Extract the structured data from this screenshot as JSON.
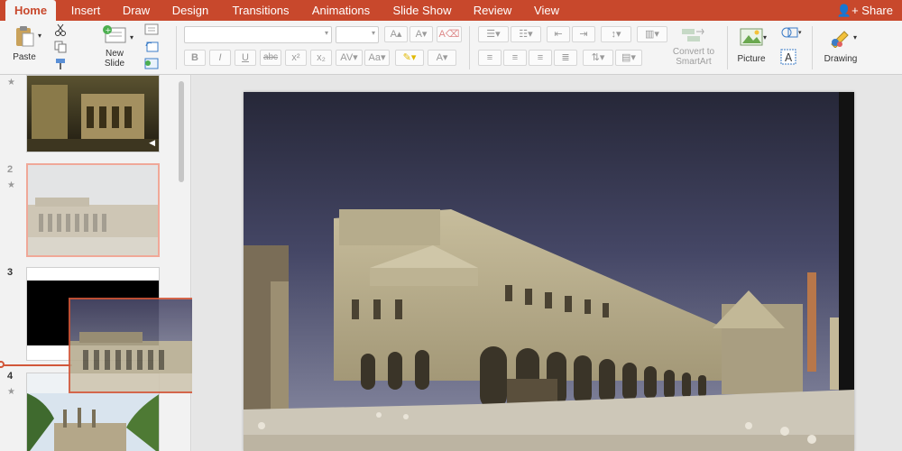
{
  "tabs": [
    "Home",
    "Insert",
    "Draw",
    "Design",
    "Transitions",
    "Animations",
    "Slide Show",
    "Review",
    "View"
  ],
  "share_label": "Share",
  "ribbon": {
    "paste": "Paste",
    "new_slide": "New Slide",
    "new_slide_line1": "New",
    "new_slide_line2": "Slide",
    "convert_line1": "Convert to",
    "convert_line2": "SmartArt",
    "picture": "Picture",
    "drawing": "Drawing",
    "bold": "B",
    "italic": "I",
    "underline": "U",
    "strike": "abc",
    "superscript": "x²",
    "subscript": "x₂"
  },
  "slides": [
    {
      "number": "",
      "star": "★"
    },
    {
      "number": "2",
      "star": "★"
    },
    {
      "number": "3",
      "star": ""
    },
    {
      "number": "4",
      "star": "★"
    }
  ],
  "colors": {
    "accent": "#c8482c",
    "selection": "#f0a898",
    "drag_border": "#d1573a"
  }
}
